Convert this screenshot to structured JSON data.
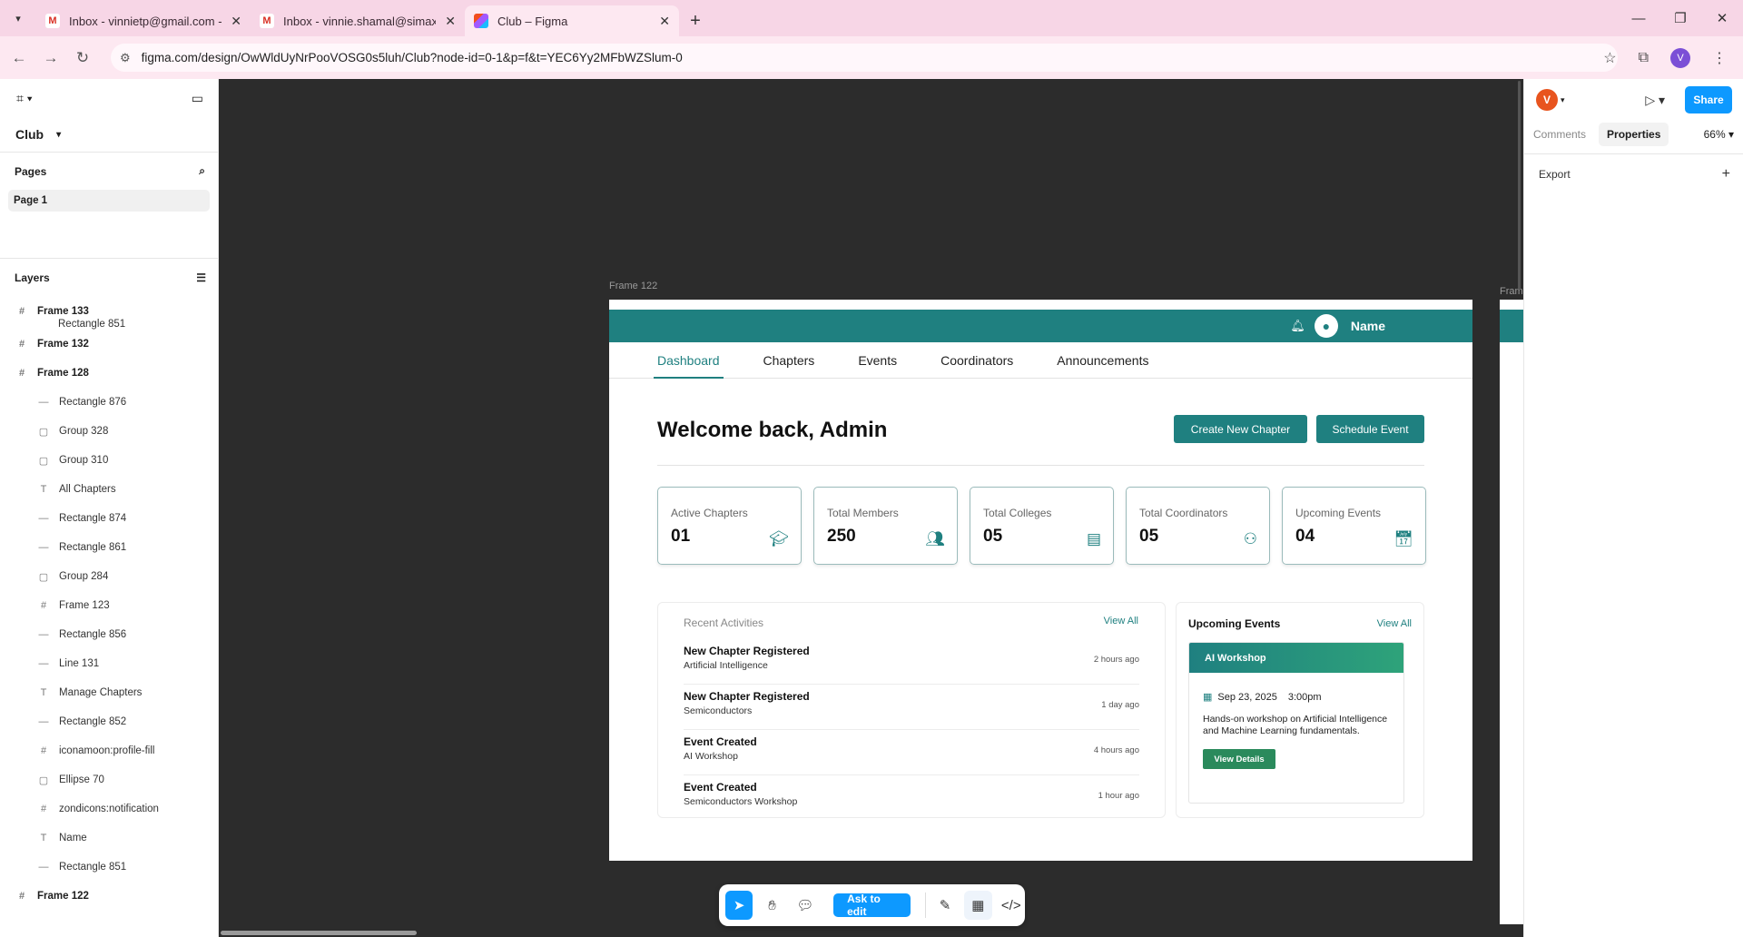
{
  "browser": {
    "tabs": [
      {
        "title": "Inbox - vinnietp@gmail.com - G",
        "icon": "gmail-icon"
      },
      {
        "title": "Inbox - vinnie.shamal@simaxsy",
        "icon": "gmail-icon"
      },
      {
        "title": "Club – Figma",
        "icon": "figma-icon"
      }
    ],
    "url": "figma.com/design/OwWldUyNrPooVOSG0s5luh/Club?node-id=0-1&p=f&t=YEC6Yy2MFbWZSlum-0",
    "profile_initial": "V"
  },
  "left_panel": {
    "file_name": "Club",
    "pages_label": "Pages",
    "pages": [
      "Page 1"
    ],
    "layers_label": "Layers",
    "layers": [
      {
        "name": "Frame 133",
        "type": "frame"
      },
      {
        "name": "Rectangle 851",
        "type": "partial"
      },
      {
        "name": "Frame 132",
        "type": "frame"
      },
      {
        "name": "Frame 128",
        "type": "frame"
      },
      {
        "name": "Rectangle 876",
        "type": "child"
      },
      {
        "name": "Group 328",
        "type": "child"
      },
      {
        "name": "Group 310",
        "type": "child"
      },
      {
        "name": "All Chapters",
        "type": "child"
      },
      {
        "name": "Rectangle 874",
        "type": "child"
      },
      {
        "name": "Rectangle 861",
        "type": "child"
      },
      {
        "name": "Group 284",
        "type": "child"
      },
      {
        "name": "Frame 123",
        "type": "child"
      },
      {
        "name": "Rectangle 856",
        "type": "child"
      },
      {
        "name": "Line 131",
        "type": "child"
      },
      {
        "name": "Manage Chapters",
        "type": "child"
      },
      {
        "name": "Rectangle 852",
        "type": "child"
      },
      {
        "name": "iconamoon:profile-fill",
        "type": "child"
      },
      {
        "name": "Ellipse 70",
        "type": "child"
      },
      {
        "name": "zondicons:notification",
        "type": "child"
      },
      {
        "name": "Name",
        "type": "child"
      },
      {
        "name": "Rectangle 851",
        "type": "child"
      },
      {
        "name": "Frame 122",
        "type": "frame"
      }
    ]
  },
  "canvas": {
    "frame_label": "Frame 122",
    "frame_label_2": "Fram",
    "design": {
      "user_name": "Name",
      "nav": [
        "Dashboard",
        "Chapters",
        "Events",
        "Coordinators",
        "Announcements"
      ],
      "welcome": "Welcome back, Admin",
      "create_button": "Create New Chapter",
      "schedule_button": "Schedule Event",
      "stats": [
        {
          "label": "Active Chapters",
          "value": "01",
          "icon": "graduation-cap-icon"
        },
        {
          "label": "Total Members",
          "value": "250",
          "icon": "users-icon"
        },
        {
          "label": "Total Colleges",
          "value": "05",
          "icon": "building-icon"
        },
        {
          "label": "Total Coordinators",
          "value": "05",
          "icon": "coordinator-icon"
        },
        {
          "label": "Upcoming Events",
          "value": "04",
          "icon": "calendar-icon"
        }
      ],
      "recent_title": "Recent Activities",
      "view_all": "View All",
      "activities": [
        {
          "title": "New Chapter Registered",
          "sub": "Artificial Intelligence",
          "time": "2 hours ago"
        },
        {
          "title": "New Chapter Registered",
          "sub": "Semiconductors",
          "time": "1 day ago"
        },
        {
          "title": "Event Created",
          "sub": "AI Workshop",
          "time": "4 hours ago"
        },
        {
          "title": "Event Created",
          "sub": "Semiconductors Workshop",
          "time": "1 hour ago"
        }
      ],
      "upcoming_title": "Upcoming Events",
      "event": {
        "name": "AI Workshop",
        "date": "Sep 23, 2025",
        "time": "3:00pm",
        "description": "Hands-on workshop on Artificial Intelligence and Machine Learning fundamentals.",
        "button": "View Details"
      }
    }
  },
  "toolbar": {
    "ask": "Ask to edit"
  },
  "right_panel": {
    "user_initial": "V",
    "share": "Share",
    "tabs": [
      "Comments",
      "Properties"
    ],
    "zoom": "66%",
    "export": "Export"
  },
  "colors": {
    "primary": "#1f8080",
    "figma_blue": "#0d99ff",
    "browser_pink": "#f7d6e6"
  }
}
